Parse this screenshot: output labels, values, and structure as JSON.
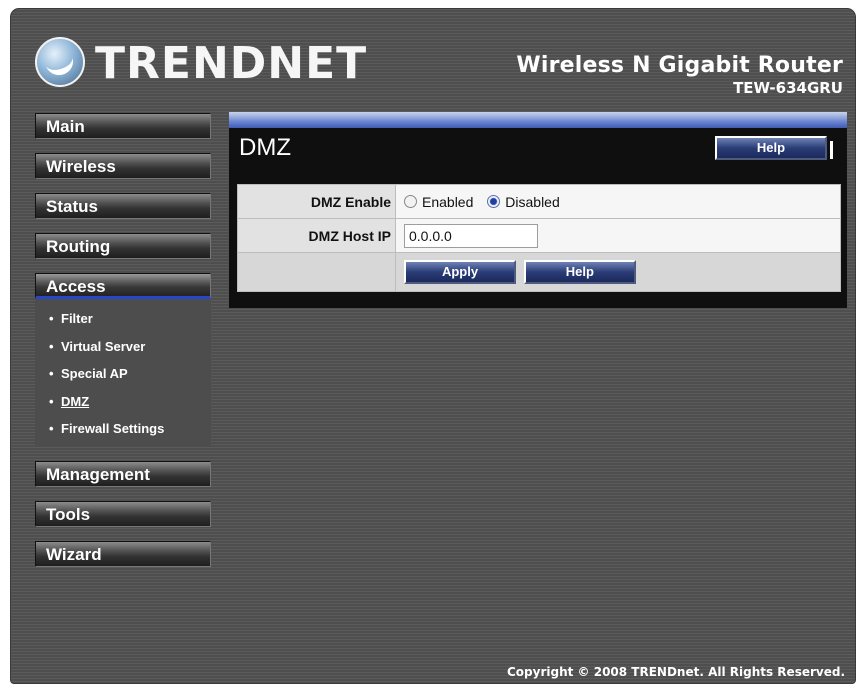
{
  "header": {
    "brand": "TRENDNET",
    "product_name": "Wireless N Gigabit Router",
    "model": "TEW-634GRU"
  },
  "sidebar": {
    "items": [
      {
        "label": "Main"
      },
      {
        "label": "Wireless"
      },
      {
        "label": "Status"
      },
      {
        "label": "Routing"
      },
      {
        "label": "Access"
      },
      {
        "label": "Management"
      },
      {
        "label": "Tools"
      },
      {
        "label": "Wizard"
      }
    ],
    "access_submenu": [
      {
        "label": "Filter"
      },
      {
        "label": "Virtual Server"
      },
      {
        "label": "Special AP"
      },
      {
        "label": "DMZ"
      },
      {
        "label": "Firewall Settings"
      }
    ],
    "active_item": "Access",
    "current_subitem": "DMZ"
  },
  "page": {
    "title": "DMZ",
    "help_label": "Help"
  },
  "form": {
    "dmz_enable_label": "DMZ Enable",
    "enabled_label": "Enabled",
    "disabled_label": "Disabled",
    "dmz_enable_value": "Disabled",
    "dmz_host_ip_label": "DMZ Host IP",
    "dmz_host_ip_value": "0.0.0.0",
    "apply_label": "Apply",
    "help_label": "Help"
  },
  "footer": {
    "copyright": "Copyright © 2008 TRENDnet. All Rights Reserved."
  },
  "colors": {
    "background": "#525252",
    "accent_blue": "#2747c8",
    "panel": "#0f0f0f"
  }
}
